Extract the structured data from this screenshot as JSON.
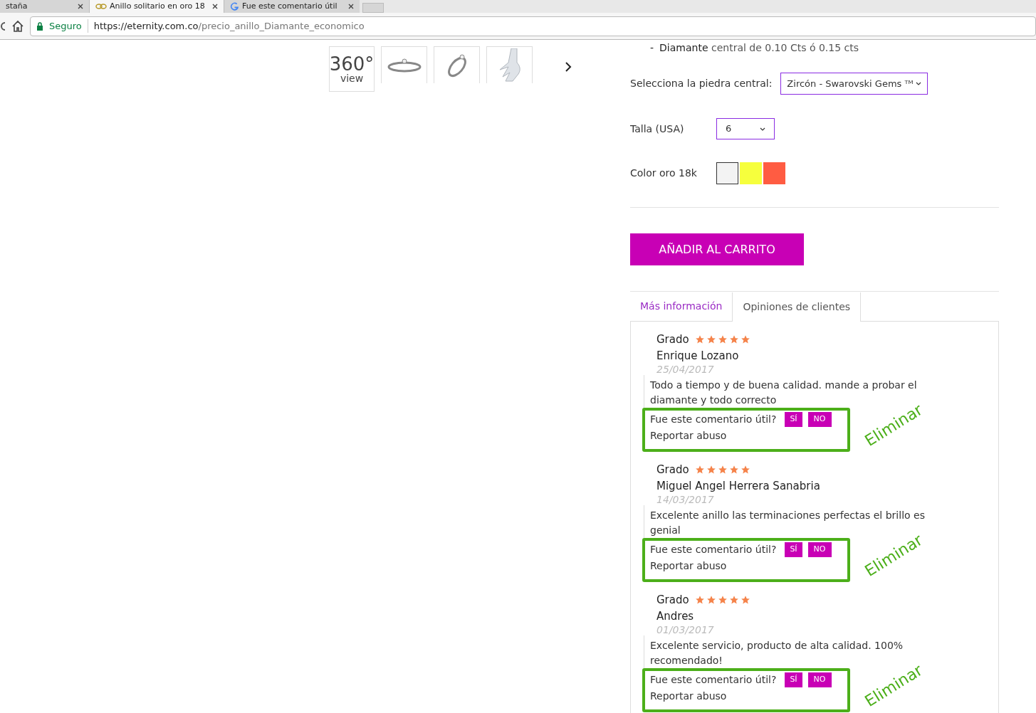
{
  "browser": {
    "tabs": [
      {
        "title": "staña",
        "selected": false,
        "kind": "plain"
      },
      {
        "title": "Anillo solitario en oro 18",
        "selected": true,
        "kind": "ring"
      },
      {
        "title": "Fue este comentario útil",
        "selected": false,
        "kind": "google"
      }
    ],
    "secure_label": "Seguro",
    "url_domain": "https://eternity.com.co",
    "url_path": "/precio_anillo_Diamante_economico"
  },
  "gallery": {
    "view360_number": "360°",
    "view360_label": "view",
    "thumbnails": [
      {
        "kind": "ring"
      },
      {
        "kind": "ring-tilted"
      },
      {
        "kind": "hand"
      }
    ]
  },
  "product": {
    "bullet": "-",
    "spec_bold": "Diamante",
    "spec": "central de 0.10 Cts ó 0.15 cts",
    "stone_label": "Selecciona la piedra central:",
    "stone_value": "Zircón - Swarovski Gems ᵀᴹ",
    "size_label": "Talla (USA)",
    "size_value": "6",
    "color_label": "Color oro 18k",
    "colors": [
      {
        "color": "#f3f3f3",
        "selected": true
      },
      {
        "color": "#f6ff3d",
        "selected": false
      },
      {
        "color": "#ff5c42",
        "selected": false
      }
    ],
    "cart_button": "AÑADIR AL CARRITO"
  },
  "tabs": [
    {
      "label": "Más información",
      "selected": false
    },
    {
      "label": "Opiniones de clientes",
      "selected": true
    }
  ],
  "reviews": [
    {
      "grade_label": "Grado",
      "stars": 5,
      "author": "Enrique Lozano",
      "date": "25/04/2017",
      "text": "Todo a tiempo y de buena calidad. mande a probar el diamante y todo correcto",
      "helpful_question": "Fue este comentario útil?",
      "yes": "SÍ",
      "no": "NO",
      "report": "Reportar abuso",
      "annotation": "Eliminar"
    },
    {
      "grade_label": "Grado",
      "stars": 5,
      "author": "Miguel Angel Herrera Sanabria",
      "date": "14/03/2017",
      "text": "Excelente anillo las terminaciones perfectas el brillo es genial",
      "helpful_question": "Fue este comentario útil?",
      "yes": "SÍ",
      "no": "NO",
      "report": "Reportar abuso",
      "annotation": "Eliminar"
    },
    {
      "grade_label": "Grado",
      "stars": 5,
      "author": "Andres",
      "date": "01/03/2017",
      "text": "Excelente servicio, producto de alta calidad. 100% recomendado!",
      "helpful_question": "Fue este comentario útil?",
      "yes": "SÍ",
      "no": "NO",
      "report": "Reportar abuso",
      "annotation": "Eliminar"
    }
  ]
}
